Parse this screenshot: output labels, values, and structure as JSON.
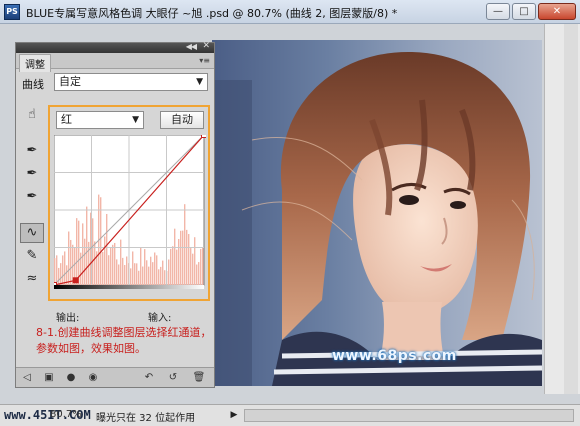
{
  "window": {
    "app_icon": "PS",
    "title": "BLUE专属写意风格色调   大眼仔 ~旭 .psd @ 80.7% (曲线 2, 图层蒙版/8) *",
    "minimize": "—",
    "maximize": "□",
    "close": "✕"
  },
  "panel": {
    "tab": "调整",
    "menu_icon": "panel-menu-icon",
    "preset_label": "曲线",
    "preset_value": "自定",
    "channel_value": "红",
    "auto_label": "自动",
    "output_label": "输出:",
    "input_label": "输入:",
    "note": "8-1.创建曲线调整图层选择红通道，参数如图，效果如图。",
    "tools": [
      "hand-target-icon",
      "black-eyedropper-icon",
      "gray-eyedropper-icon",
      "white-eyedropper-icon",
      "curve-point-icon",
      "pencil-icon",
      "smooth-icon"
    ],
    "bottom_icons": [
      "back-arrow-icon",
      "expand-view-icon",
      "clip-layer-icon",
      "visibility-icon",
      "previous-state-icon",
      "reset-icon",
      "trash-icon"
    ]
  },
  "curve": {
    "channel": "red",
    "points": [
      [
        0,
        0
      ],
      [
        37,
        8
      ],
      [
        255,
        255
      ]
    ],
    "histogram_color": "#f2b6a8",
    "curve_color": "#c8201e"
  },
  "status": {
    "site": "www.45IT.COM",
    "zoom": "80.7%",
    "text": "曝光只在 32 位起作用"
  },
  "canvas": {
    "watermark": "www.68ps.com"
  }
}
